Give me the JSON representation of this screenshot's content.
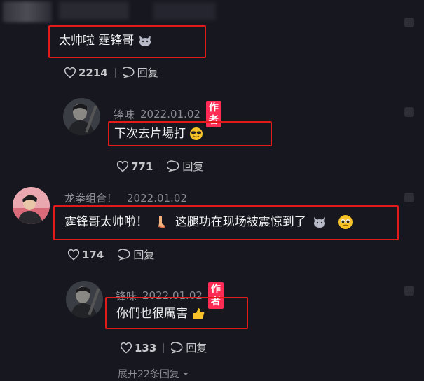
{
  "comments": [
    {
      "text": "太帅啦 霆锋哥",
      "likes": "2214",
      "reply_label": "回复"
    },
    {
      "name": "锋味",
      "date": "2022.01.02",
      "badge": "作者",
      "text": "下次去片場打",
      "likes": "771",
      "reply_label": "回复"
    },
    {
      "name": "龙拳组合！",
      "date": "2022.01.02",
      "text_1": "霆锋哥太帅啦！",
      "text_2": "这腿功在现场被震惊到了",
      "likes": "174",
      "reply_label": "回复"
    },
    {
      "name": "锋味",
      "date": "2022.01.02",
      "badge": "作者",
      "text": "你們也很厲害",
      "likes": "133",
      "reply_label": "回复"
    }
  ],
  "expand_replies": "展开22条回复",
  "icons": [
    "heart-icon",
    "reply-bubble-icon",
    "cat-face-emoji",
    "sunglasses-emoji",
    "leg-emoji",
    "pleading-face-emoji",
    "thumbs-up-emoji",
    "chevron-down-icon"
  ],
  "colors": {
    "background": "#16171f",
    "author_badge": "#fe2c55",
    "highlight_box": "#e11a1a"
  }
}
